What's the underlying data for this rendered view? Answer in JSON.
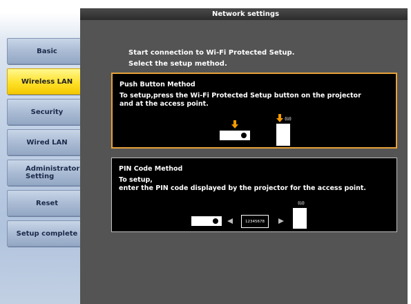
{
  "header": {
    "title": "Network settings"
  },
  "sidebar": {
    "items": [
      {
        "label": "Basic",
        "active": false
      },
      {
        "label": "Wireless LAN",
        "active": true
      },
      {
        "label": "Security",
        "active": false
      },
      {
        "label": "Wired LAN",
        "active": false
      },
      {
        "label": "Administrator Setting",
        "active": false
      },
      {
        "label": "Reset",
        "active": false
      },
      {
        "label": "Setup complete",
        "active": false
      }
    ]
  },
  "main": {
    "intro_line1": "Start connection to Wi-Fi Protected Setup.",
    "intro_line2": "Select the setup method.",
    "push_button": {
      "title": "Push Button Method",
      "desc_line1": "To setup,press the Wi-Fi Protected Setup button on the projector",
      "desc_line2": "and at the access point."
    },
    "pin_code": {
      "title": "PIN Code Method",
      "desc_line1": "To setup,",
      "desc_line2": "enter the PIN code displayed by the projector for the access point.",
      "code_sample": "12345678"
    },
    "signal_text": "((ı))"
  },
  "colors": {
    "active_nav": "#ffe12a",
    "highlight_border": "#e8a23a",
    "arrow": "#f29a00",
    "panel_bg": "#545454"
  }
}
